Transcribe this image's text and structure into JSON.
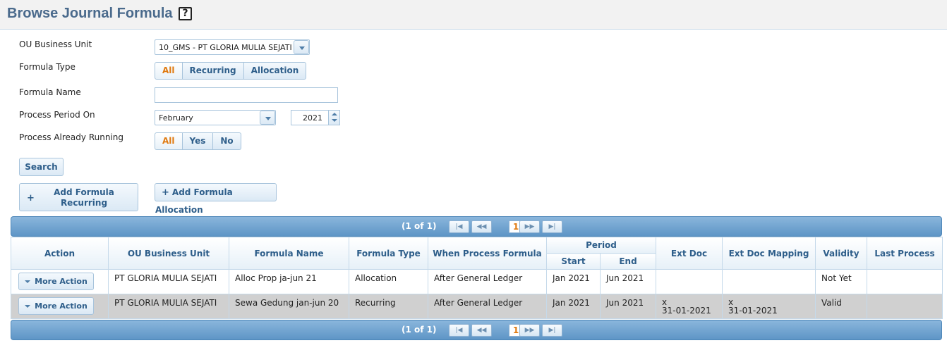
{
  "header": {
    "title": "Browse Journal Formula",
    "help": "?"
  },
  "form": {
    "ou_label": "OU Business Unit",
    "ou_value": "10_GMS - PT GLORIA MULIA SEJATI",
    "formula_type_label": "Formula Type",
    "formula_type_options": [
      "All",
      "Recurring",
      "Allocation"
    ],
    "formula_type_selected": "All",
    "formula_name_label": "Formula Name",
    "formula_name_value": "",
    "process_period_label": "Process Period On",
    "month_value": "February",
    "year_value": "2021",
    "running_label": "Process Already Running",
    "running_options": [
      "All",
      "Yes",
      "No"
    ],
    "running_selected": "All",
    "search_button": "Search",
    "add_recurring_line1": "Add Formula",
    "add_recurring_line2": "Recurring",
    "add_allocation_button": "Add Formula Allocation"
  },
  "pager": {
    "count": "(1 of 1)",
    "page": "1"
  },
  "table": {
    "headers": {
      "action": "Action",
      "ou": "OU Business Unit",
      "formula_name": "Formula Name",
      "formula_type": "Formula Type",
      "when": "When Process Formula",
      "period": "Period",
      "start": "Start",
      "end": "End",
      "ext_doc": "Ext Doc",
      "ext_doc_mapping": "Ext Doc Mapping",
      "validity": "Validity",
      "last_process": "Last Process"
    },
    "rows": [
      {
        "action": "More Action",
        "ou": "PT GLORIA MULIA SEJATI",
        "formula_name": "Alloc Prop ja-jun 21",
        "formula_type": "Allocation",
        "when": "After General Ledger",
        "start": "Jan 2021",
        "end": "Jun 2021",
        "ext_doc_1": "",
        "ext_doc_2": "",
        "ext_map_1": "",
        "ext_map_2": "",
        "validity": "Not Yet",
        "last_process": ""
      },
      {
        "action": "More Action",
        "ou": "PT GLORIA MULIA SEJATI",
        "formula_name": "Sewa Gedung jan-jun 20",
        "formula_type": "Recurring",
        "when": "After General Ledger",
        "start": "Jan 2021",
        "end": "Jun 2021",
        "ext_doc_1": "x",
        "ext_doc_2": "31-01-2021",
        "ext_map_1": "x",
        "ext_map_2": "31-01-2021",
        "validity": "Valid",
        "last_process": ""
      }
    ]
  },
  "colors": {
    "title": "#4a6a8c",
    "accent": "#e07a10",
    "header_bar": "#5e95c6",
    "alt_row": "#d0d0d0"
  }
}
